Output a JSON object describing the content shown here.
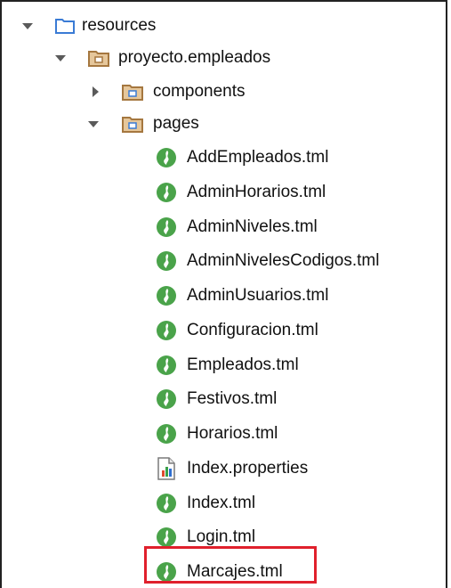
{
  "tree": {
    "root": {
      "label": "resources"
    },
    "project": {
      "label": "proyecto.empleados"
    },
    "components": {
      "label": "components"
    },
    "pages": {
      "label": "pages"
    },
    "files": [
      {
        "label": "AddEmpleados.tml",
        "icon": "tapestry-template-icon"
      },
      {
        "label": "AdminHorarios.tml",
        "icon": "tapestry-template-icon"
      },
      {
        "label": "AdminNiveles.tml",
        "icon": "tapestry-template-icon"
      },
      {
        "label": "AdminNivelesCodigos.tml",
        "icon": "tapestry-template-icon"
      },
      {
        "label": "AdminUsuarios.tml",
        "icon": "tapestry-template-icon"
      },
      {
        "label": "Configuracion.tml",
        "icon": "tapestry-template-icon"
      },
      {
        "label": "Empleados.tml",
        "icon": "tapestry-template-icon"
      },
      {
        "label": "Festivos.tml",
        "icon": "tapestry-template-icon"
      },
      {
        "label": "Horarios.tml",
        "icon": "tapestry-template-icon"
      },
      {
        "label": "Index.properties",
        "icon": "properties-file-icon"
      },
      {
        "label": "Index.tml",
        "icon": "tapestry-template-icon"
      },
      {
        "label": "Login.tml",
        "icon": "tapestry-template-icon"
      },
      {
        "label": "Marcajes.tml",
        "icon": "tapestry-template-icon",
        "highlighted": true
      }
    ]
  },
  "colors": {
    "highlight": "#e0202c",
    "template_icon": "#4aa34a",
    "folder_blue": "#3a7bd5",
    "package_brown": "#b4875a"
  }
}
